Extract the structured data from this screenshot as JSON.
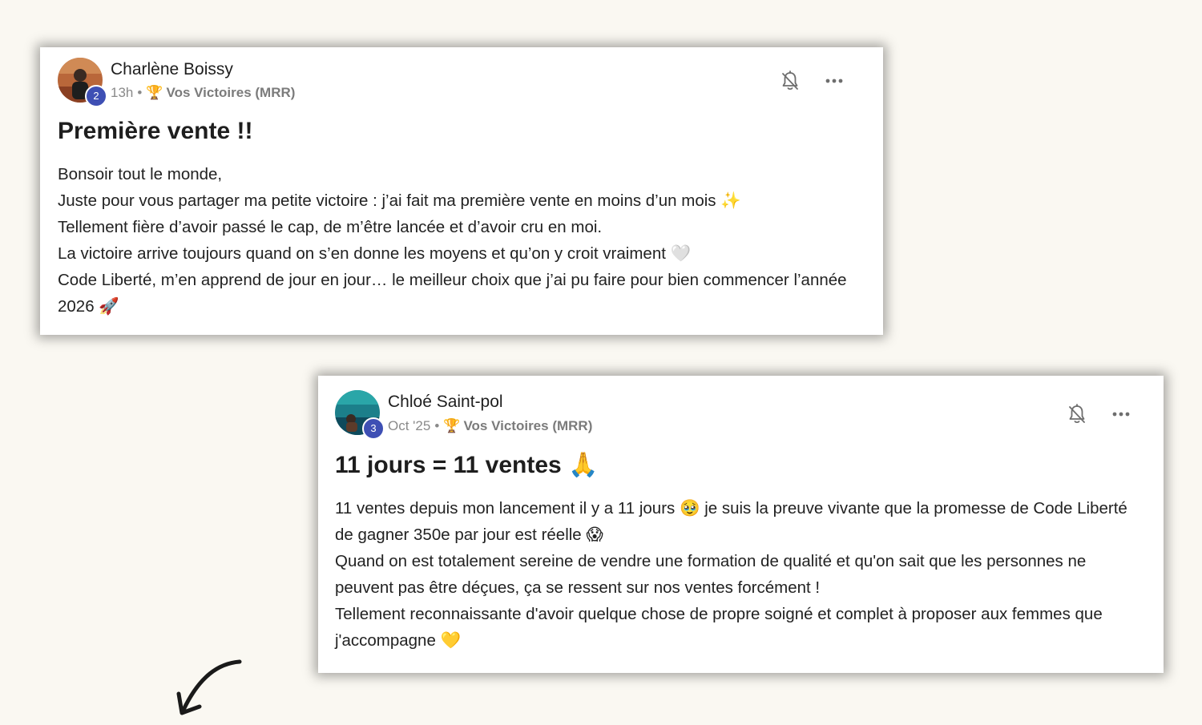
{
  "posts": [
    {
      "author": "Charlène Boissy",
      "level": "2",
      "time": "13h",
      "separator": "•",
      "category_icon": "🏆",
      "category": "Vos Victoires (MRR)",
      "title": "Première vente !!",
      "body": [
        "Bonsoir tout le monde,",
        "Juste pour vous partager ma petite victoire : j’ai fait ma première vente en moins d’un mois ✨",
        "Tellement fière d’avoir passé le cap, de m’être lancée et d’avoir cru en moi.",
        "La victoire arrive toujours quand on s’en donne les moyens et qu’on y croit vraiment 🤍",
        "Code Liberté, m’en apprend de jour en jour… le meilleur choix que j’ai pu faire pour bien commencer l’année 2026 🚀"
      ],
      "icons": {
        "bell": "bell-off-icon",
        "menu": "more-horizontal-icon"
      }
    },
    {
      "author": "Chloé Saint-pol",
      "level": "3",
      "time": "Oct '25",
      "separator": "•",
      "category_icon": "🏆",
      "category": "Vos Victoires (MRR)",
      "title": "11 jours = 11 ventes 🙏",
      "body": [
        "11 ventes depuis mon lancement il y a 11 jours 🥹 je suis la preuve vivante que la promesse de Code Liberté de gagner 350e par jour est réelle 😱",
        "Quand on est totalement sereine de vendre une formation de qualité et qu'on sait que les personnes ne peuvent pas être déçues, ça se ressent sur nos ventes forcément !",
        "Tellement reconnaissante d'avoir quelque chose de propre soigné et complet à proposer aux femmes que j'accompagne 💛"
      ],
      "icons": {
        "bell": "bell-off-icon",
        "menu": "more-horizontal-icon"
      }
    }
  ],
  "colors": {
    "background": "#faf8f2",
    "card": "#ffffff",
    "level_badge": "#3e4fb4",
    "meta_text": "#8a8a8a"
  },
  "decoration": {
    "arrow_icon": "curved-arrow-down-left-icon"
  }
}
